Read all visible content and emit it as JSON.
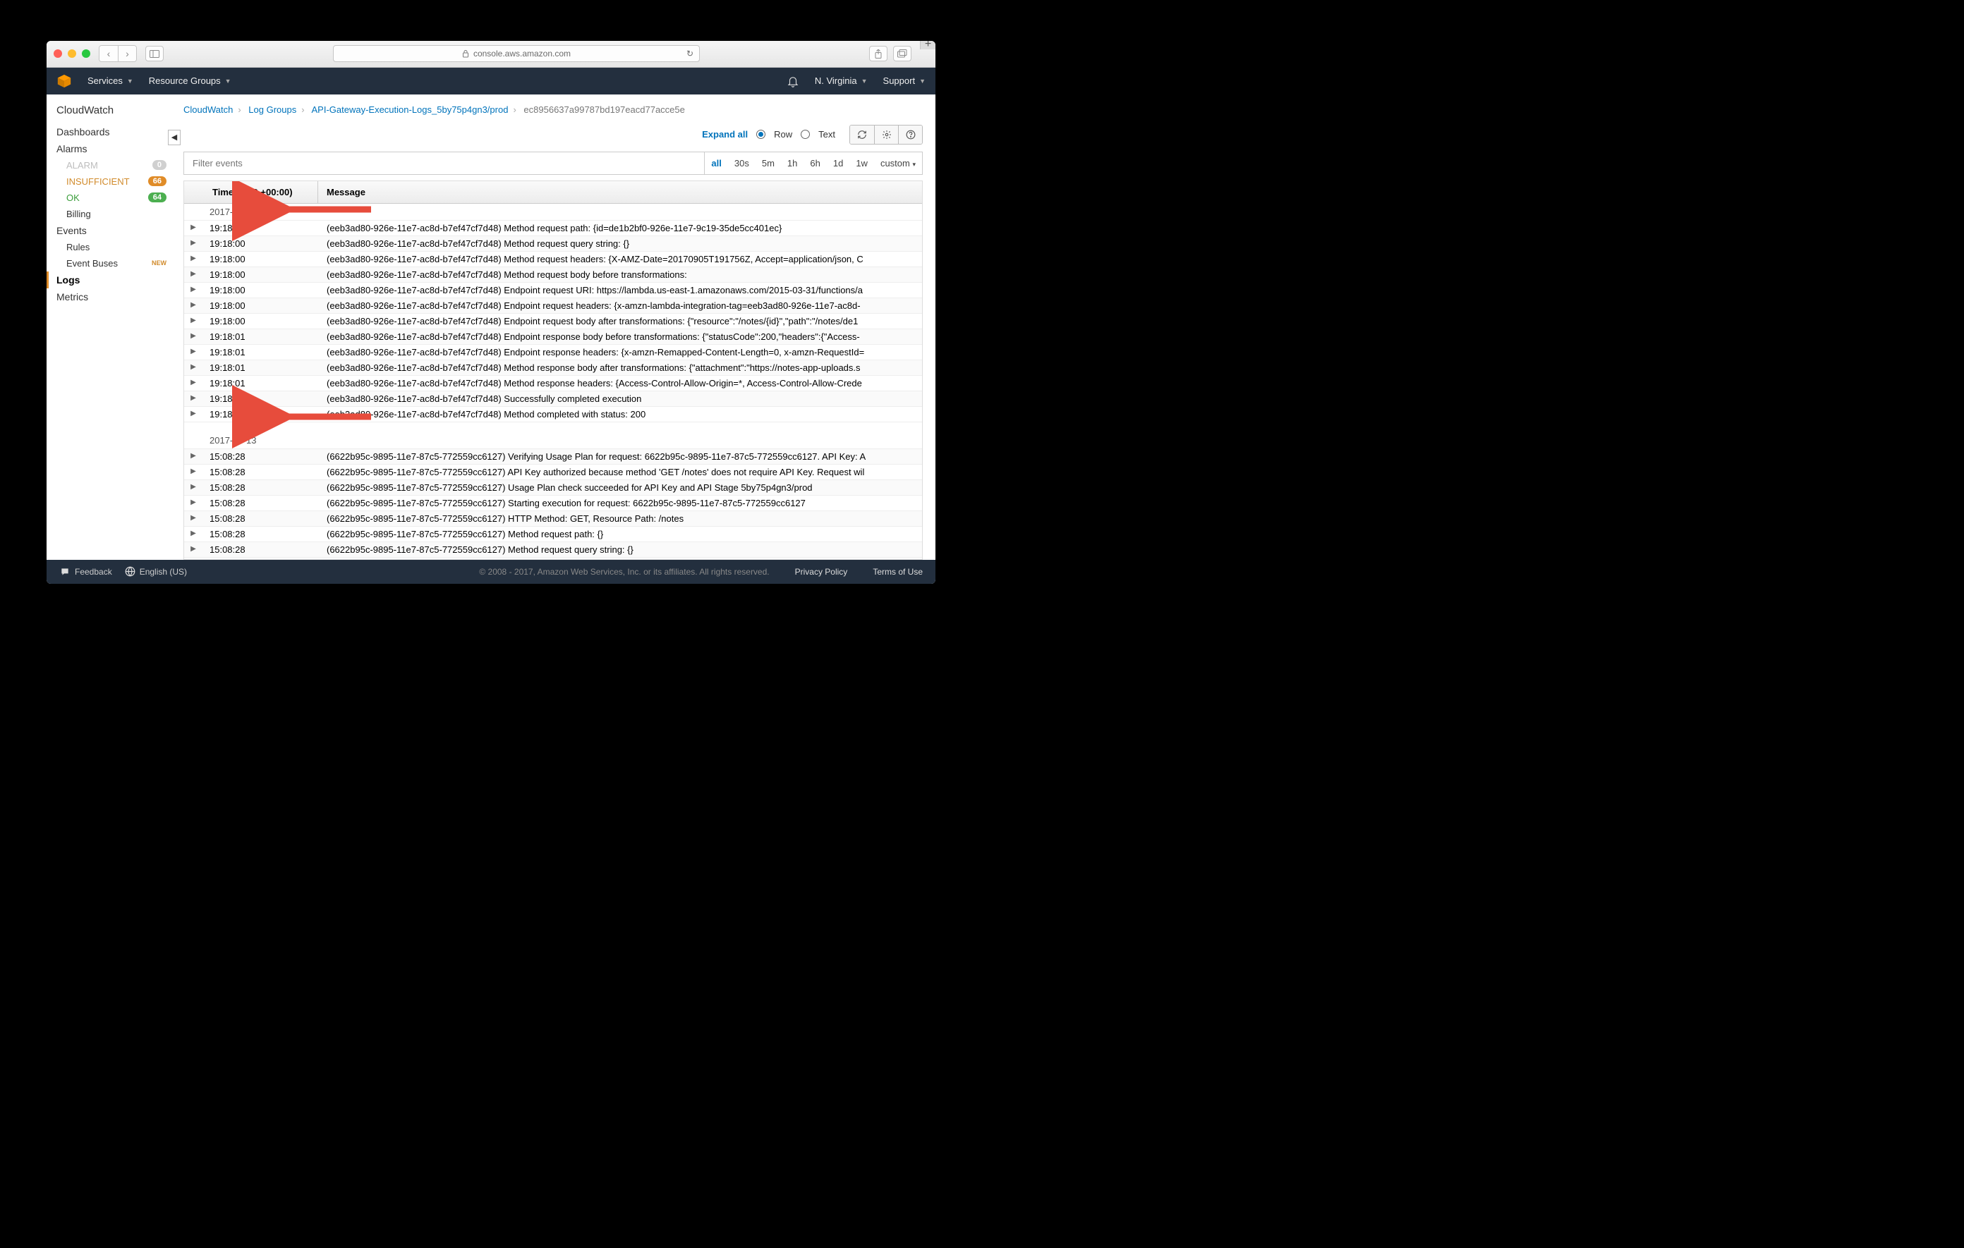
{
  "browser": {
    "url_host": "console.aws.amazon.com"
  },
  "awsnav": {
    "services": "Services",
    "resource_groups": "Resource Groups",
    "region": "N. Virginia",
    "support": "Support"
  },
  "sidebar": {
    "title": "CloudWatch",
    "items": [
      {
        "label": "Dashboards"
      },
      {
        "label": "Alarms"
      },
      {
        "label": "Events"
      },
      {
        "label": "Logs"
      },
      {
        "label": "Metrics"
      }
    ],
    "alarms": {
      "alarm": {
        "label": "ALARM",
        "count": "0"
      },
      "insuff": {
        "label": "INSUFFICIENT",
        "count": "66"
      },
      "ok": {
        "label": "OK",
        "count": "64"
      },
      "billing": {
        "label": "Billing"
      }
    },
    "events_sub": {
      "rules": "Rules",
      "buses": "Event Buses",
      "new": "NEW"
    }
  },
  "breadcrumbs": {
    "a": "CloudWatch",
    "b": "Log Groups",
    "c": "API-Gateway-Execution-Logs_5by75p4gn3/prod",
    "d": "ec8956637a99787bd197eacd77acce5e"
  },
  "toolbar": {
    "expand": "Expand all",
    "row": "Row",
    "text": "Text",
    "filter_placeholder": "Filter events",
    "ranges": [
      "all",
      "30s",
      "5m",
      "1h",
      "6h",
      "1d",
      "1w",
      "custom"
    ],
    "range_active": "all"
  },
  "table": {
    "col_time": "Time (UTC +00:00)",
    "col_msg": "Message"
  },
  "logs": [
    {
      "type": "date",
      "value": "2017-09-05"
    },
    {
      "type": "row",
      "t": "19:18:00",
      "m": "(eeb3ad80-926e-11e7-ac8d-b7ef47cf7d48) Method request path: {id=de1b2bf0-926e-11e7-9c19-35de5cc401ec}"
    },
    {
      "type": "row",
      "t": "19:18:00",
      "m": "(eeb3ad80-926e-11e7-ac8d-b7ef47cf7d48) Method request query string: {}"
    },
    {
      "type": "row",
      "t": "19:18:00",
      "m": "(eeb3ad80-926e-11e7-ac8d-b7ef47cf7d48) Method request headers: {X-AMZ-Date=20170905T191756Z, Accept=application/json, C"
    },
    {
      "type": "row",
      "t": "19:18:00",
      "m": "(eeb3ad80-926e-11e7-ac8d-b7ef47cf7d48) Method request body before transformations:"
    },
    {
      "type": "row",
      "t": "19:18:00",
      "m": "(eeb3ad80-926e-11e7-ac8d-b7ef47cf7d48) Endpoint request URI: https://lambda.us-east-1.amazonaws.com/2015-03-31/functions/a"
    },
    {
      "type": "row",
      "t": "19:18:00",
      "m": "(eeb3ad80-926e-11e7-ac8d-b7ef47cf7d48) Endpoint request headers: {x-amzn-lambda-integration-tag=eeb3ad80-926e-11e7-ac8d-"
    },
    {
      "type": "row",
      "t": "19:18:00",
      "m": "(eeb3ad80-926e-11e7-ac8d-b7ef47cf7d48) Endpoint request body after transformations: {\"resource\":\"/notes/{id}\",\"path\":\"/notes/de1"
    },
    {
      "type": "row",
      "t": "19:18:01",
      "m": "(eeb3ad80-926e-11e7-ac8d-b7ef47cf7d48) Endpoint response body before transformations: {\"statusCode\":200,\"headers\":{\"Access-"
    },
    {
      "type": "row",
      "t": "19:18:01",
      "m": "(eeb3ad80-926e-11e7-ac8d-b7ef47cf7d48) Endpoint response headers: {x-amzn-Remapped-Content-Length=0, x-amzn-RequestId="
    },
    {
      "type": "row",
      "t": "19:18:01",
      "m": "(eeb3ad80-926e-11e7-ac8d-b7ef47cf7d48) Method response body after transformations: {\"attachment\":\"https://notes-app-uploads.s"
    },
    {
      "type": "row",
      "t": "19:18:01",
      "m": "(eeb3ad80-926e-11e7-ac8d-b7ef47cf7d48) Method response headers: {Access-Control-Allow-Origin=*, Access-Control-Allow-Crede"
    },
    {
      "type": "row",
      "t": "19:18:01",
      "m": "(eeb3ad80-926e-11e7-ac8d-b7ef47cf7d48) Successfully completed execution"
    },
    {
      "type": "row",
      "t": "19:18:01",
      "m": "(eeb3ad80-926e-11e7-ac8d-b7ef47cf7d48) Method completed with status: 200"
    },
    {
      "type": "gap"
    },
    {
      "type": "date",
      "value": "2017-09-13"
    },
    {
      "type": "row",
      "t": "15:08:28",
      "m": "(6622b95c-9895-11e7-87c5-772559cc6127) Verifying Usage Plan for request: 6622b95c-9895-11e7-87c5-772559cc6127. API Key: A"
    },
    {
      "type": "row",
      "t": "15:08:28",
      "m": "(6622b95c-9895-11e7-87c5-772559cc6127) API Key authorized because method 'GET /notes' does not require API Key. Request wil"
    },
    {
      "type": "row",
      "t": "15:08:28",
      "m": "(6622b95c-9895-11e7-87c5-772559cc6127) Usage Plan check succeeded for API Key and API Stage 5by75p4gn3/prod"
    },
    {
      "type": "row",
      "t": "15:08:28",
      "m": "(6622b95c-9895-11e7-87c5-772559cc6127) Starting execution for request: 6622b95c-9895-11e7-87c5-772559cc6127"
    },
    {
      "type": "row",
      "t": "15:08:28",
      "m": "(6622b95c-9895-11e7-87c5-772559cc6127) HTTP Method: GET, Resource Path: /notes"
    },
    {
      "type": "row",
      "t": "15:08:28",
      "m": "(6622b95c-9895-11e7-87c5-772559cc6127) Method request path: {}"
    },
    {
      "type": "row",
      "t": "15:08:28",
      "m": "(6622b95c-9895-11e7-87c5-772559cc6127) Method request query string: {}"
    }
  ],
  "footer": {
    "feedback": "Feedback",
    "lang": "English (US)",
    "copy": "© 2008 - 2017, Amazon Web Services, Inc. or its affiliates. All rights reserved.",
    "privacy": "Privacy Policy",
    "terms": "Terms of Use"
  }
}
